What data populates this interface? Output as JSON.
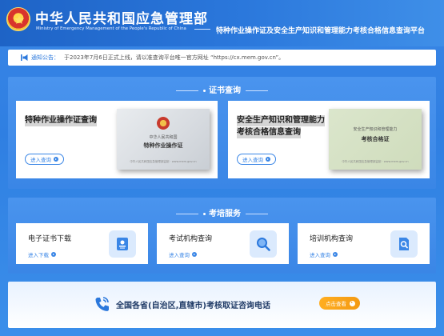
{
  "header": {
    "title": "中华人民共和国应急管理部",
    "subtitle_en": "Ministry of Emergency Management of the People's Republic of China",
    "platform": "特种作业操作证及安全生产知识和管理能力考核合格信息查询平台"
  },
  "notice": {
    "label": "通知公告：",
    "text": "于2023年7月6日正式上线，请以准查询平台唯一官方网址 “https://cx.mem.gov.cn”。"
  },
  "cert_section": {
    "title": "证书查询",
    "cards": [
      {
        "title": "特种作业操作证查询",
        "button": "进入查询",
        "image": {
          "line1": "中华人民共和国",
          "line2": "特种作业操作证",
          "foot": "中华人民共和国应急管理部监制 · www.mem.gov.cn"
        }
      },
      {
        "title_line1": "安全生产知识和管理能力",
        "title_line2": "考核合格信息查询",
        "button": "进入查询",
        "image": {
          "line1": "安全生产知识和管理能力",
          "line2": "考核合格证",
          "foot": "中华人民共和国应急管理部监制 · www.mem.gov.cn"
        }
      }
    ]
  },
  "service_section": {
    "title": "考培服务",
    "cards": [
      {
        "title": "电子证书下载",
        "link": "进入下载",
        "icon": "certificate-icon"
      },
      {
        "title": "考试机构查询",
        "link": "进入查询",
        "icon": "search-icon"
      },
      {
        "title": "培训机构查询",
        "link": "进入查询",
        "icon": "document-search-icon"
      }
    ]
  },
  "bottom": {
    "text": "全国各省(自治区,直辖市)考核取证咨询电话",
    "button": "点击查看"
  },
  "colors": {
    "primary": "#3a86e6",
    "header": "#2b78dc",
    "accent": "#f49a12"
  }
}
